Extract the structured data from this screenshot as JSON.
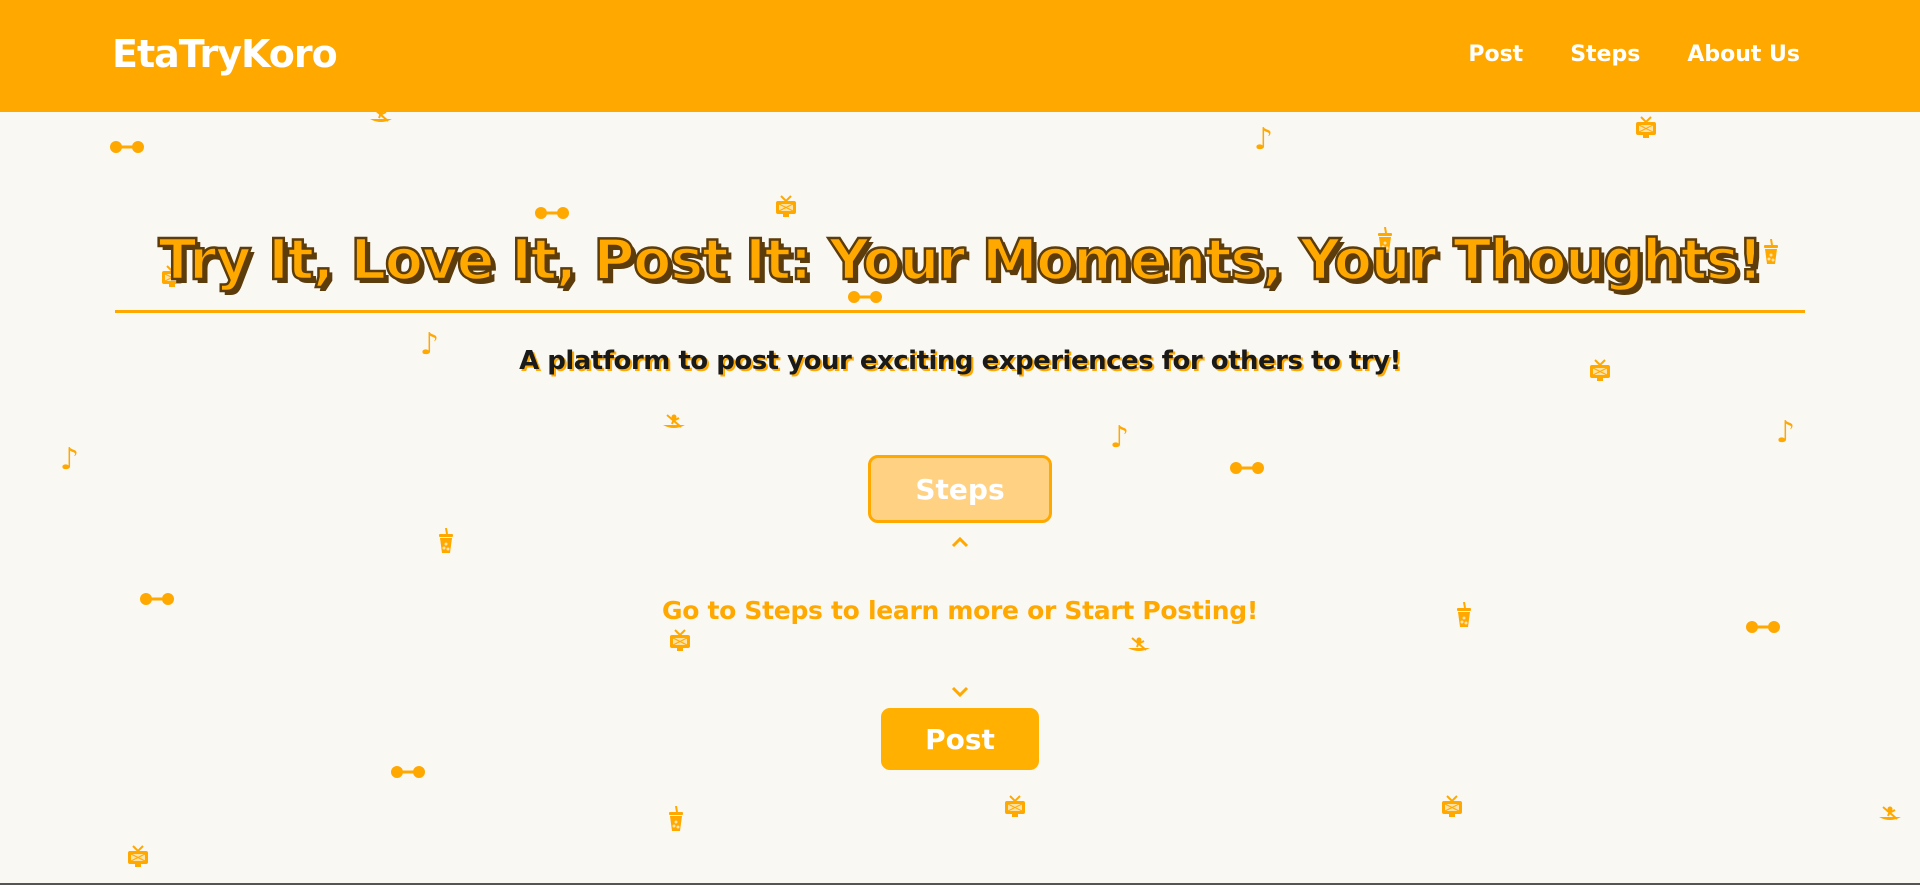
{
  "navbar": {
    "brand": "EtaTryKoro",
    "links": [
      "Post",
      "Steps",
      "About Us"
    ],
    "background": "#ffa800"
  },
  "hero": {
    "title": "Try It, Love It, Post It: Your Moments, Your Thoughts!",
    "subtitle": "A platform to post your exciting experiences for others to try!",
    "steps_button": "Steps",
    "cta_text": "Go to Steps to learn more or Start Posting!",
    "post_button": "Post",
    "chevron_up": "^",
    "chevron_down": "v"
  },
  "decor_icons": [
    "dumbbell-icon",
    "music-note-icon",
    "tv-icon",
    "boba-cup-icon",
    "rowing-boat-icon"
  ],
  "colors": {
    "accent": "#ffa800",
    "title_outline": "#5c3c0a",
    "background": "#faf8f3",
    "steps_button_bg": "#ffd283"
  }
}
